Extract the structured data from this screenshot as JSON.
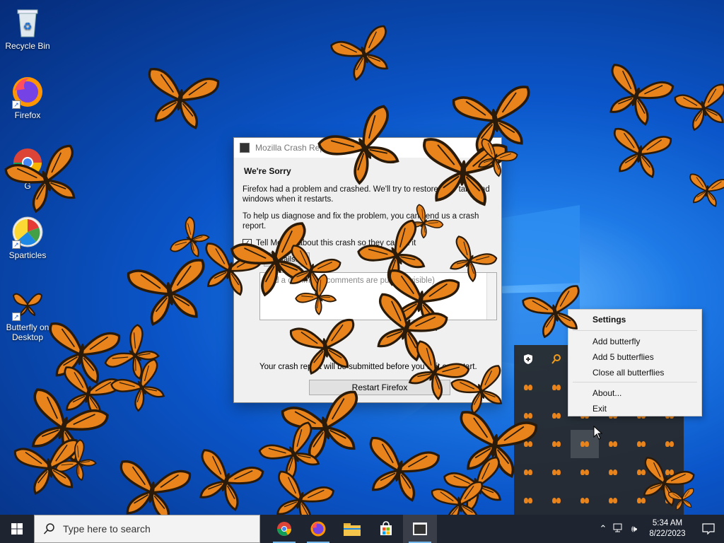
{
  "desktop": {
    "icons": [
      {
        "label": "Recycle Bin",
        "icon": "recycle-bin-icon"
      },
      {
        "label": "Firefox",
        "icon": "firefox-icon"
      },
      {
        "label": "G",
        "icon": "chrome-icon"
      },
      {
        "label": "Sparticles",
        "icon": "sparticles-icon"
      },
      {
        "label": "Butterfly on Desktop",
        "icon": "butterfly-icon"
      }
    ]
  },
  "dialog": {
    "title": "Mozilla Crash Rep",
    "heading": "We're Sorry",
    "message": "Firefox had a problem and crashed. We'll try to restore your tabs and windows when it restarts.",
    "help_text": "To help us diagnose and fix the problem, you can send us a crash report.",
    "checkbox_label": "Tell Mozilla about this crash so they can fix it",
    "details_button": "Details...",
    "comments_placeholder": "Add a comment (comments are publicly visible)",
    "footer": "Your crash report will be submitted before you quit or restart.",
    "restart_button": "Restart Firefox"
  },
  "context_menu": {
    "items": [
      {
        "label": "Settings",
        "bold": true
      },
      {
        "label": "Add butterfly"
      },
      {
        "label": "Add 5 butterflies"
      },
      {
        "label": "Close all butterflies"
      },
      {
        "label": "About..."
      },
      {
        "label": "Exit"
      }
    ]
  },
  "taskbar": {
    "search_placeholder": "Type here to search",
    "apps": [
      "chrome-icon",
      "firefox-icon",
      "file-explorer-icon",
      "microsoft-store-icon",
      "crash-reporter-icon"
    ],
    "time": "5:34 AM",
    "date": "8/22/2023"
  },
  "colors": {
    "butterfly_orange": "#e8841b",
    "butterfly_dark": "#2a1a0a",
    "taskbar": "#1e2430"
  }
}
